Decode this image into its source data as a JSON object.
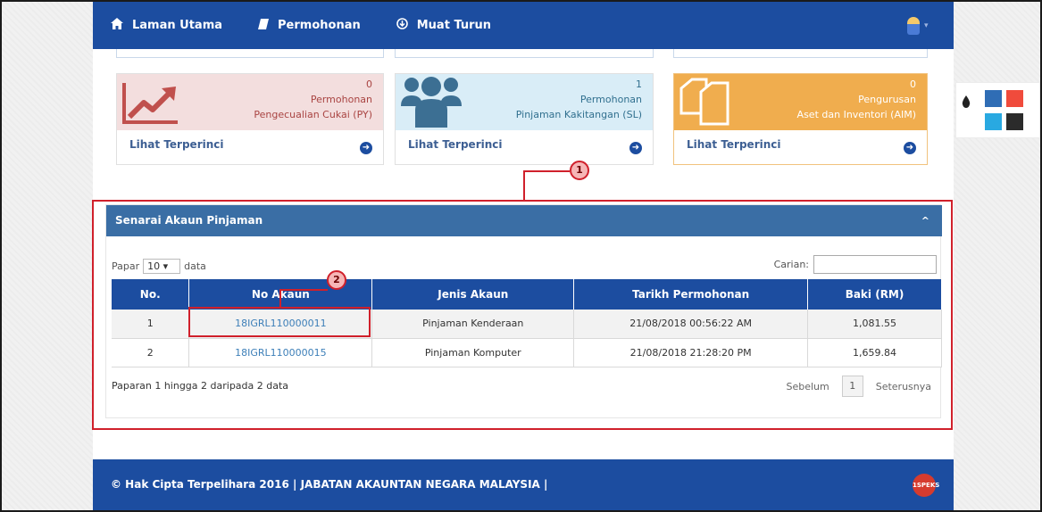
{
  "nav": {
    "home_label": "Laman Utama",
    "applications_label": "Permohonan",
    "download_label": "Muat Turun"
  },
  "cards": [
    {
      "count": "0",
      "label_line1": "Permohonan",
      "label_line2": "Pengecualian Cukai (PY)",
      "more_label": "Lihat Terperinci",
      "icon": "trend-chart-icon",
      "color": "#c0504d"
    },
    {
      "count": "1",
      "label_line1": "Permohonan",
      "label_line2": "Pinjaman Kakitangan (SL)",
      "more_label": "Lihat Terperinci",
      "icon": "users-icon",
      "color": "#3c6f93"
    },
    {
      "count": "0",
      "label_line1": "Pengurusan",
      "label_line2": "Aset dan Inventori (AIM)",
      "more_label": "Lihat Terperinci",
      "icon": "documents-icon",
      "color": "#f0ad4e"
    }
  ],
  "panel": {
    "title": "Senarai Akaun Pinjaman",
    "show_prefix": "Papar",
    "show_value": "10",
    "show_suffix": "data",
    "search_label": "Carian:",
    "search_value": "",
    "columns": [
      "No.",
      "No Akaun",
      "Jenis Akaun",
      "Tarikh Permohonan",
      "Baki (RM)"
    ],
    "rows": [
      [
        "1",
        "18IGRL110000011",
        "Pinjaman Kenderaan",
        "21/08/2018 00:56:22 AM",
        "1,081.55"
      ],
      [
        "2",
        "18IGRL110000015",
        "Pinjaman Komputer",
        "21/08/2018 21:28:20 PM",
        "1,659.84"
      ]
    ],
    "info": "Paparan 1 hingga 2 daripada 2 data",
    "prev_label": "Sebelum",
    "page": "1",
    "next_label": "Seterusnya"
  },
  "annotations": [
    "1",
    "2"
  ],
  "footer": {
    "text": "© Hak Cipta Terpelihara 2016 | JABATAN AKAUNTAN NEGARA MALAYSIA |",
    "logo_text": "1SPEKS"
  },
  "colors": {
    "nav_bg": "#1c4da0",
    "panel_head": "#3a6ea5",
    "annotation": "#d0202b",
    "swatches": [
      "#2f6db5",
      "#f04b3c",
      "#29a9e1",
      "#2b2b2b"
    ]
  }
}
